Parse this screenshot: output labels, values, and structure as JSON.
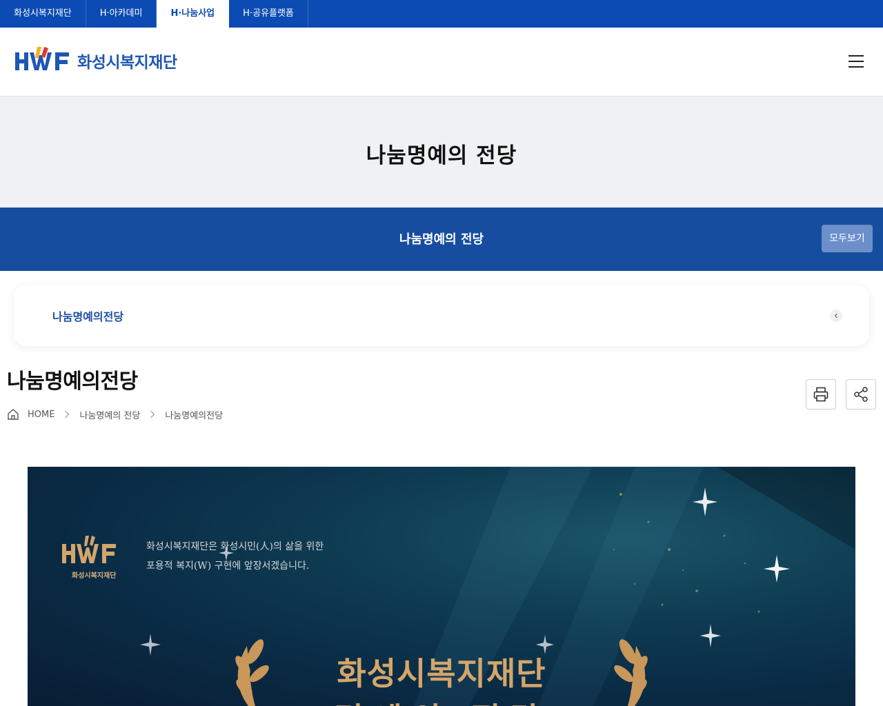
{
  "top_tabs": [
    {
      "label": "화성시복지재단",
      "active": false
    },
    {
      "label": "H·아카데미",
      "active": false
    },
    {
      "label": "H·나눔사업",
      "active": true
    },
    {
      "label": "H·공유플랫폼",
      "active": false
    }
  ],
  "header": {
    "logo_text": "화성시복지재단",
    "menu_icon": "hamburger-menu-icon"
  },
  "hero": {
    "title": "나눔명예의 전당"
  },
  "subbar": {
    "title": "나눔명예의 전당",
    "view_all_label": "모두보기"
  },
  "submenu": {
    "label": "나눔명예의전당"
  },
  "page": {
    "title": "나눔명예의전당",
    "breadcrumb": [
      "HOME",
      "나눔명예의 전당",
      "나눔명예의전당"
    ],
    "print_icon": "printer-icon",
    "share_icon": "share-icon"
  },
  "banner": {
    "logo_caption": "화성시복지재단",
    "line1": "화성시복지재단은 화성시민(人)의 삶을 위한",
    "line2": "포용적 복지(W) 구현에 앞장서겠습니다.",
    "title": "화성시복지재단",
    "title2": "명예의 전당"
  },
  "colors": {
    "primary_blue": "#0b4bb3",
    "subbar_blue": "#174d9e",
    "hero_bg": "#f0f1f3",
    "gold": "#d4a56a"
  }
}
